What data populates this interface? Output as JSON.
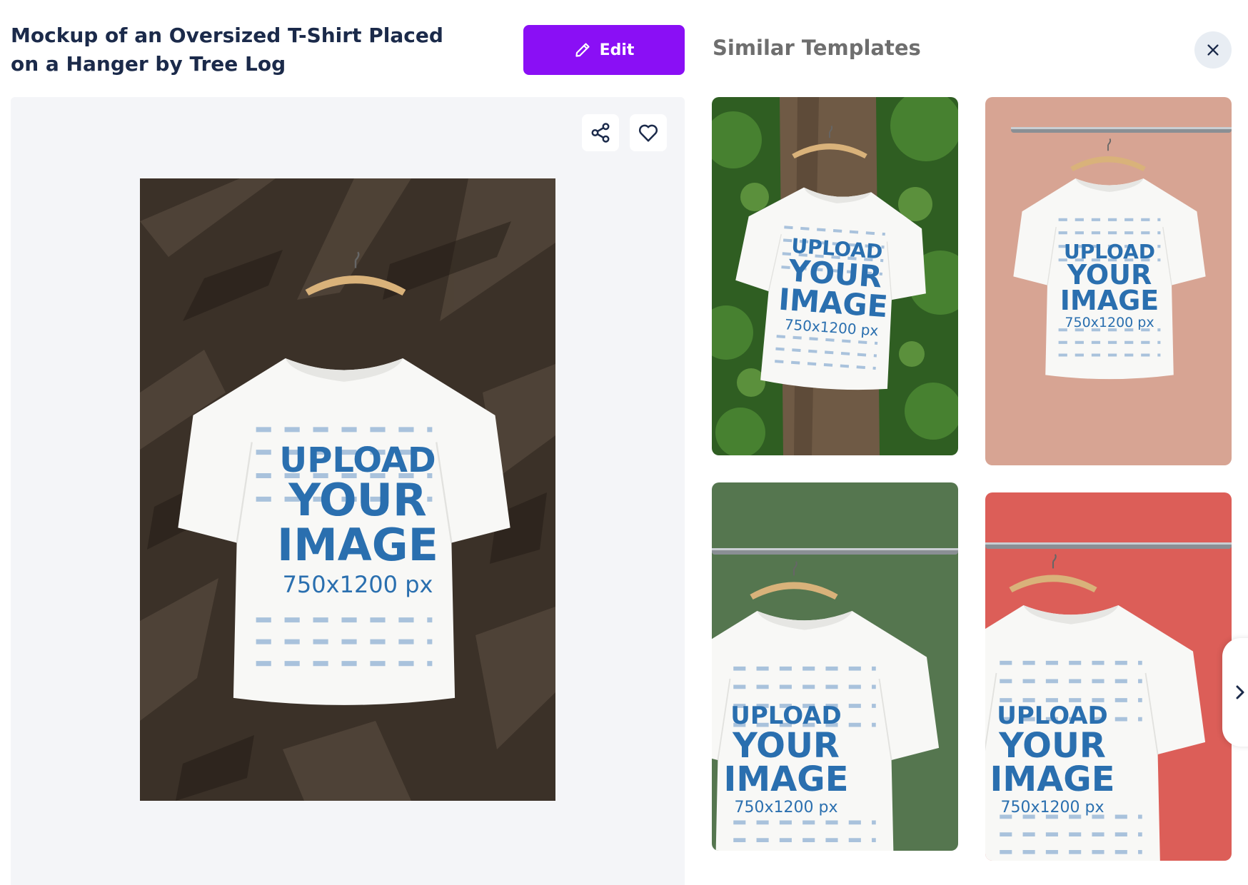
{
  "template": {
    "title": "Mockup of an Oversized T-Shirt Placed on a Hanger by Tree Log",
    "edit_label": "Edit",
    "edit_color": "#8a0ff5",
    "share_icon": "share-icon",
    "favorite_icon": "heart-icon"
  },
  "placeholder": {
    "line1": "UPLOAD",
    "line2": "YOUR",
    "line3": "IMAGE",
    "size": "750x1200 px"
  },
  "similar": {
    "title": "Similar Templates",
    "close_icon": "close-icon",
    "next_icon": "chevron-right-icon",
    "cards": [
      {
        "background": "tree-foliage"
      },
      {
        "background": "#d7a493"
      },
      {
        "background": "#55764f"
      },
      {
        "background": "#dc5e58"
      }
    ]
  }
}
